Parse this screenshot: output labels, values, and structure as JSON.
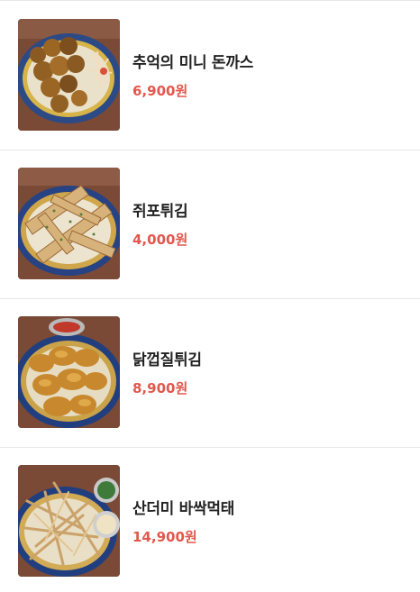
{
  "accent_color": "#e2574c",
  "menu": {
    "items": [
      {
        "name": "추억의 미니 돈까스",
        "price": "6,900원",
        "image": "mini-pork-cutlet-photo"
      },
      {
        "name": "쥐포튀김",
        "price": "4,000원",
        "image": "fried-filefish-jerky-photo"
      },
      {
        "name": "닭껍질튀김",
        "price": "8,900원",
        "image": "fried-chicken-skin-photo"
      },
      {
        "name": "산더미 바싹먹태",
        "price": "14,900원",
        "image": "crispy-dried-pollack-photo"
      }
    ]
  }
}
